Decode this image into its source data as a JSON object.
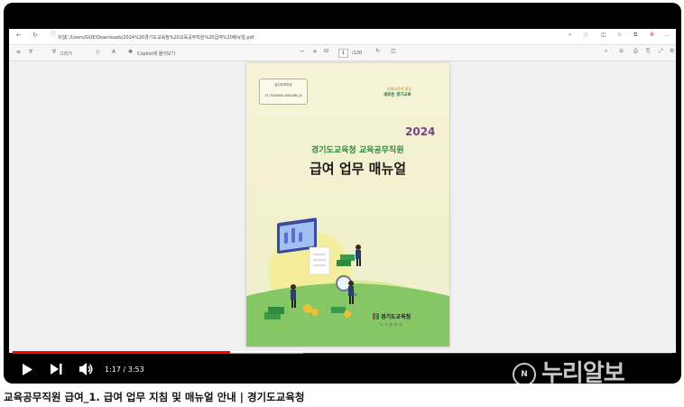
{
  "browser": {
    "file_label": "파일",
    "url": "C:/Users/GOE/Downloads/2024%20경기도교육청%20교육공무직원%20급여%20매뉴얼.pdf"
  },
  "pdf_toolbar": {
    "draw_label": "그리기",
    "copilot_label": "Copilot에 물어보기",
    "zoom_minus": "−",
    "zoom_plus": "+",
    "page_current": "1",
    "page_total": "/120"
  },
  "document": {
    "id_label": "발간등록번호",
    "id_number": "71-7530000-000188-10",
    "logo_line1": "미래교육의 중심",
    "logo_line2": "새로운 경기교육",
    "year": "2024",
    "subtitle": "경기도교육청 교육공무직원",
    "title": "급여 업무 매뉴얼",
    "publisher": "경기도교육청",
    "publisher_sub": "노사협력과"
  },
  "player": {
    "time": "1:17 / 3:53",
    "progress_fraction": 0.33,
    "buffer_fraction": 0.44,
    "progress_color": "#ff0000"
  },
  "watermark": {
    "circle_text": "N",
    "text": "누리알보"
  },
  "caption": "교육공무직원 급여_1. 급여 업무 지침 및 매뉴얼 안내 |  경기도교육청",
  "icons": [
    "back-icon",
    "refresh-icon",
    "info-icon",
    "star-icon",
    "extensions-icon",
    "list-icon",
    "filter-icon",
    "draw-icon",
    "eraser-icon",
    "read-aloud-icon",
    "search-icon",
    "fit-page-icon",
    "rotate-icon",
    "two-page-icon",
    "save-icon",
    "print-icon",
    "play-icon",
    "next-icon",
    "volume-icon"
  ]
}
